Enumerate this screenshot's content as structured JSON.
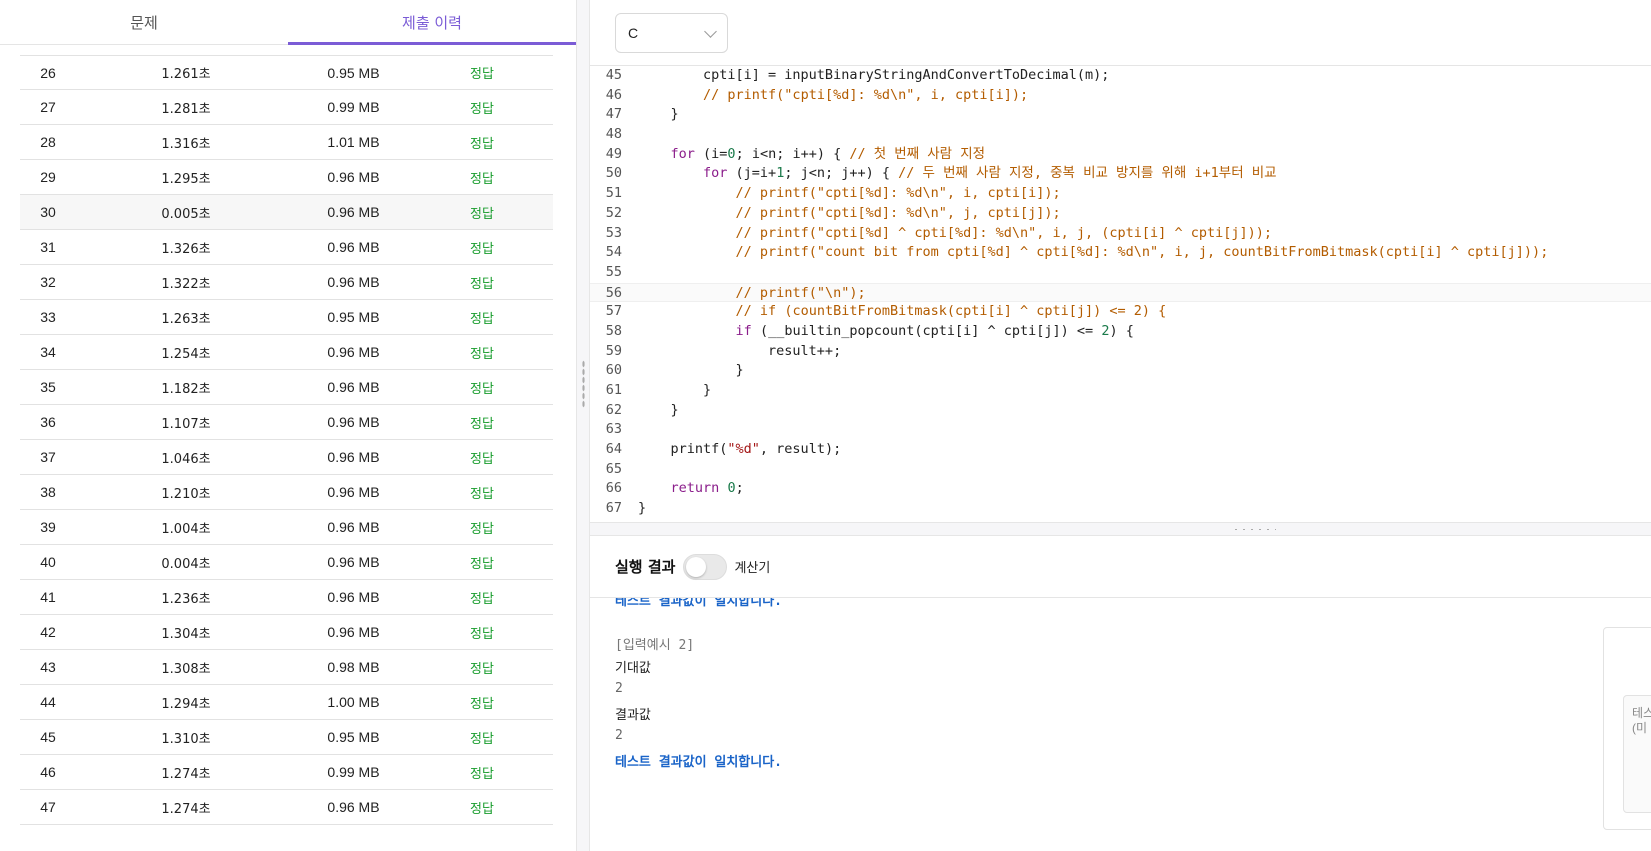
{
  "tabs": [
    {
      "label": "문제"
    },
    {
      "label": "제출 이력"
    }
  ],
  "submissions": [
    {
      "no": "26",
      "time": "1.261초",
      "memory": "0.95 MB",
      "result": "정답"
    },
    {
      "no": "27",
      "time": "1.281초",
      "memory": "0.99 MB",
      "result": "정답"
    },
    {
      "no": "28",
      "time": "1.316초",
      "memory": "1.01 MB",
      "result": "정답"
    },
    {
      "no": "29",
      "time": "1.295초",
      "memory": "0.96 MB",
      "result": "정답"
    },
    {
      "no": "30",
      "time": "0.005초",
      "memory": "0.96 MB",
      "result": "정답"
    },
    {
      "no": "31",
      "time": "1.326초",
      "memory": "0.96 MB",
      "result": "정답"
    },
    {
      "no": "32",
      "time": "1.322초",
      "memory": "0.96 MB",
      "result": "정답"
    },
    {
      "no": "33",
      "time": "1.263초",
      "memory": "0.95 MB",
      "result": "정답"
    },
    {
      "no": "34",
      "time": "1.254초",
      "memory": "0.96 MB",
      "result": "정답"
    },
    {
      "no": "35",
      "time": "1.182초",
      "memory": "0.96 MB",
      "result": "정답"
    },
    {
      "no": "36",
      "time": "1.107초",
      "memory": "0.96 MB",
      "result": "정답"
    },
    {
      "no": "37",
      "time": "1.046초",
      "memory": "0.96 MB",
      "result": "정답"
    },
    {
      "no": "38",
      "time": "1.210초",
      "memory": "0.96 MB",
      "result": "정답"
    },
    {
      "no": "39",
      "time": "1.004초",
      "memory": "0.96 MB",
      "result": "정답"
    },
    {
      "no": "40",
      "time": "0.004초",
      "memory": "0.96 MB",
      "result": "정답"
    },
    {
      "no": "41",
      "time": "1.236초",
      "memory": "0.96 MB",
      "result": "정답"
    },
    {
      "no": "42",
      "time": "1.304초",
      "memory": "0.96 MB",
      "result": "정답"
    },
    {
      "no": "43",
      "time": "1.308초",
      "memory": "0.98 MB",
      "result": "정답"
    },
    {
      "no": "44",
      "time": "1.294초",
      "memory": "1.00 MB",
      "result": "정답"
    },
    {
      "no": "45",
      "time": "1.310초",
      "memory": "0.95 MB",
      "result": "정답"
    },
    {
      "no": "46",
      "time": "1.274초",
      "memory": "0.99 MB",
      "result": "정답"
    },
    {
      "no": "47",
      "time": "1.274초",
      "memory": "0.96 MB",
      "result": "정답"
    }
  ],
  "language": {
    "selected": "C"
  },
  "editor": {
    "lines": [
      {
        "n": "45",
        "html": "        cpti[i] = inputBinaryStringAndConvertToDecimal(m);"
      },
      {
        "n": "46",
        "html": "        <span class='cm'>// printf(\"cpti[%d]: %d\\n\", i, cpti[i]);</span>"
      },
      {
        "n": "47",
        "html": "    }"
      },
      {
        "n": "48",
        "html": ""
      },
      {
        "n": "49",
        "html": "    <span class='kw'>for</span> (i=<span class='num'>0</span>; i&lt;n; i++) { <span class='cm'>// 첫 번째 사람 지정</span>"
      },
      {
        "n": "50",
        "html": "        <span class='kw'>for</span> (j=i+<span class='num'>1</span>; j&lt;n; j++) { <span class='cm'>// 두 번째 사람 지정, 중복 비교 방지를 위해 i+1부터 비교</span>"
      },
      {
        "n": "51",
        "html": "            <span class='cm'>// printf(\"cpti[%d]: %d\\n\", i, cpti[i]);</span>"
      },
      {
        "n": "52",
        "html": "            <span class='cm'>// printf(\"cpti[%d]: %d\\n\", j, cpti[j]);</span>"
      },
      {
        "n": "53",
        "html": "            <span class='cm'>// printf(\"cpti[%d] ^ cpti[%d]: %d\\n\", i, j, (cpti[i] ^ cpti[j]));</span>"
      },
      {
        "n": "54",
        "html": "            <span class='cm'>// printf(\"count bit from cpti[%d] ^ cpti[%d]: %d\\n\", i, j, countBitFromBitmask(cpti[i] ^ cpti[j]));</span>"
      },
      {
        "n": "55",
        "html": ""
      },
      {
        "n": "56",
        "html": "            <span class='cm'>// printf(\"\\n\");</span>"
      },
      {
        "n": "57",
        "html": "            <span class='cm'>// if (countBitFromBitmask(cpti[i] ^ cpti[j]) &lt;= 2) {</span>"
      },
      {
        "n": "58",
        "html": "            <span class='kw'>if</span> (__builtin_popcount(cpti[i] ^ cpti[j]) &lt;= <span class='num'>2</span>) {"
      },
      {
        "n": "59",
        "html": "                result++;"
      },
      {
        "n": "60",
        "html": "            }"
      },
      {
        "n": "61",
        "html": "        }"
      },
      {
        "n": "62",
        "html": "    }"
      },
      {
        "n": "63",
        "html": ""
      },
      {
        "n": "64",
        "html": "    printf(<span class='str'>\"%d\"</span>, result);"
      },
      {
        "n": "65",
        "html": ""
      },
      {
        "n": "66",
        "html": "    <span class='kw'>return</span> <span class='num'>0</span>;"
      },
      {
        "n": "67",
        "html": "}"
      }
    ],
    "active_line": "56"
  },
  "result_panel": {
    "title": "실행 결과",
    "toggle_label": "계산기",
    "toggle_on": false,
    "prev_ok_text": "테스트 결과값이 일치합니다.",
    "example_label": "[입력예시 2]",
    "expected_label": "기대값",
    "expected_value": "2",
    "actual_label": "결과값",
    "actual_value": "2",
    "ok_text": "테스트 결과값이 일치합니다.",
    "side_text_1": "테스",
    "side_text_2": "(미"
  },
  "colors": {
    "accent": "#7b5cd6",
    "correct": "#1a9d2e",
    "ok_text": "#1a64c8",
    "keyword": "#8b1d8b",
    "comment": "#b35c00"
  }
}
